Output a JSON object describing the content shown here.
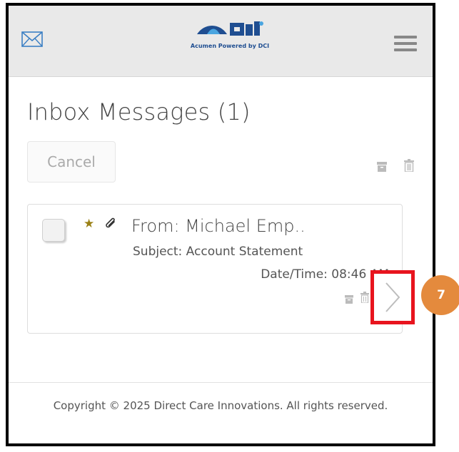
{
  "header": {
    "logo_caption": "Acumen Powered by DCI",
    "brand_color": "#1f4e91",
    "icons": [
      "mail-icon",
      "hamburger-menu-icon"
    ]
  },
  "page": {
    "title": "Inbox Messages (1)",
    "cancel_label": "Cancel"
  },
  "message": {
    "from": "From: Michael Emp..",
    "subject": "Subject: Account Statement",
    "datetime": "Date/Time: 08:46 AM",
    "starred": true,
    "has_attachment": true
  },
  "footer": {
    "copyright": "Copyright © 2025 Direct Care Innovations. All rights reserved."
  },
  "annotation": {
    "step_number": "7",
    "badge_color": "#e48a3d",
    "highlight_color": "#e8141e"
  }
}
